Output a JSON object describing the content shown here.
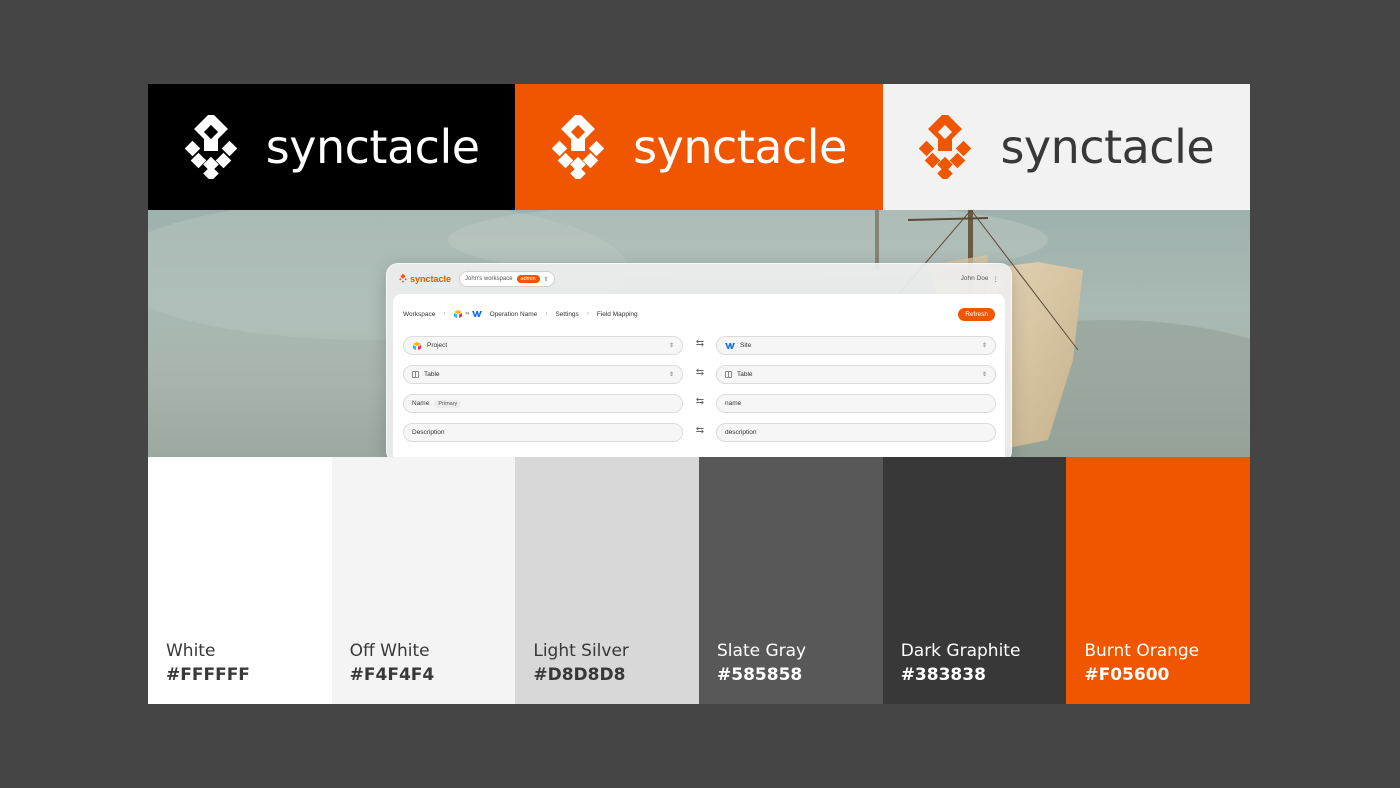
{
  "brand": {
    "wordmark": "synctacle",
    "panels": [
      {
        "bg": "#000000",
        "fg": "#FFFFFF",
        "icon": "#FFFFFF"
      },
      {
        "bg": "#F05600",
        "fg": "#FFFFFF",
        "icon": "#FFFFFF"
      },
      {
        "bg": "#F2F2F2",
        "fg": "#383838",
        "icon": "#F05600"
      }
    ]
  },
  "app": {
    "brand": "synctacle",
    "workspace": "John's workspace",
    "role": "admin",
    "user": "John Doe",
    "breadcrumb": {
      "workspace": "Workspace",
      "operation": "Operation Name",
      "settings": "Settings",
      "page": "Field Mapping"
    },
    "refresh_label": "Refresh",
    "rows": [
      {
        "left": "Project",
        "right": "Site"
      },
      {
        "left": "Table",
        "right": "Table"
      },
      {
        "left": "Name",
        "left_tag": "Primary",
        "right": "name"
      },
      {
        "left": "Description",
        "right": "description"
      }
    ]
  },
  "palette": [
    {
      "name": "White",
      "hex": "#FFFFFF",
      "text": "#383838"
    },
    {
      "name": "Off White",
      "hex": "#F4F4F4",
      "text": "#383838"
    },
    {
      "name": "Light Silver",
      "hex": "#D8D8D8",
      "text": "#383838"
    },
    {
      "name": "Slate Gray",
      "hex": "#585858",
      "text": "#FFFFFF"
    },
    {
      "name": "Dark Graphite",
      "hex": "#383838",
      "text": "#FFFFFF"
    },
    {
      "name": "Burnt Orange",
      "hex": "#F05600",
      "text": "#FFFFFF"
    }
  ]
}
